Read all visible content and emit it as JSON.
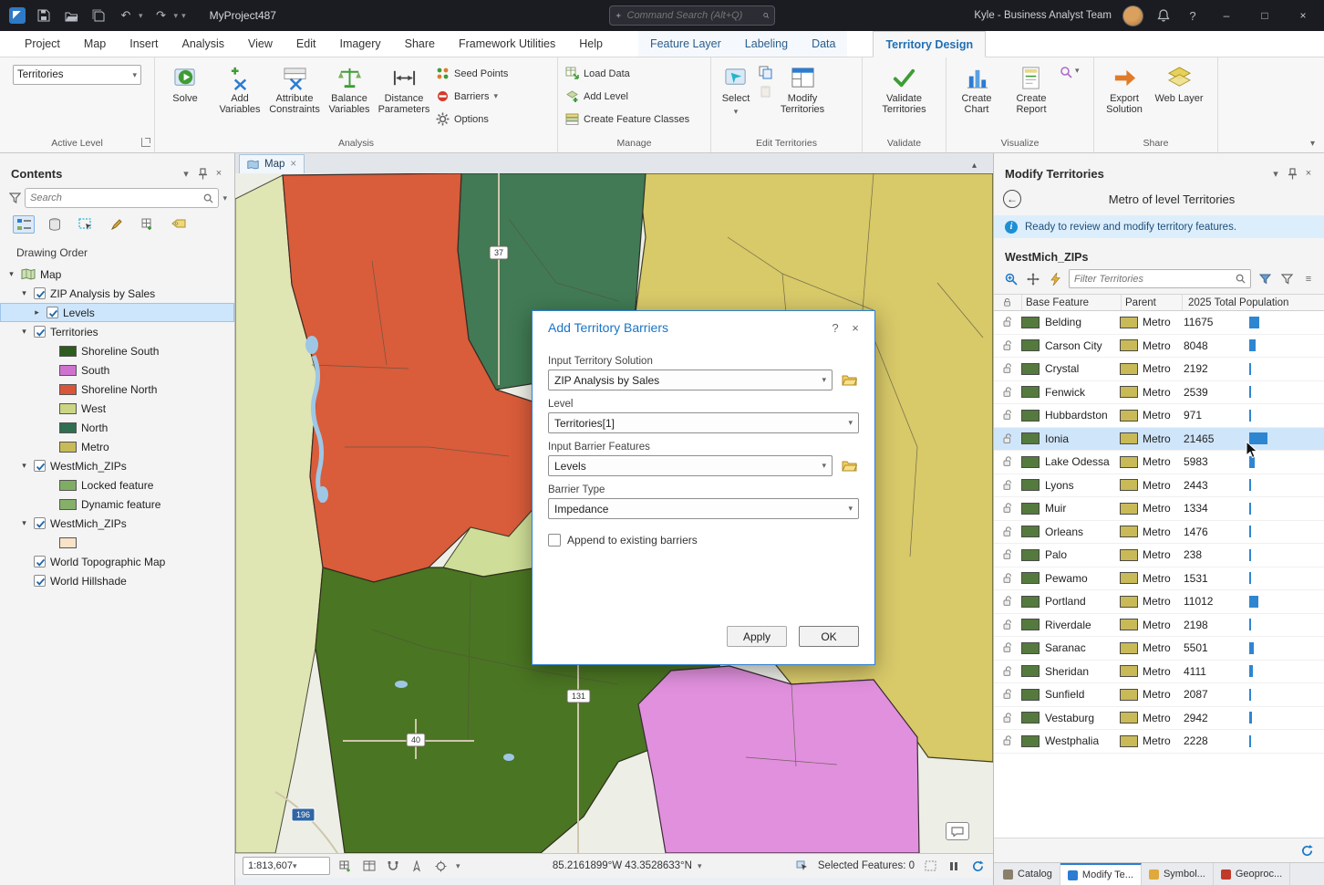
{
  "icons": {
    "help": "?",
    "close_x": "×",
    "minimize": "–",
    "maximize": "□",
    "chevron_down": "▾",
    "chevron_up": "▴",
    "undo": "↶",
    "redo": "↷",
    "hamburger": "≡"
  },
  "colors": {
    "accent": "#1f6fb5",
    "selection": "#cfe5fa",
    "info_bar": "#dceefb",
    "bar_blue": "#2e86d1",
    "territory_red": "#d95c3b",
    "territory_teal": "#417a54",
    "territory_khaki": "#d8c969",
    "territory_green": "#4a7522",
    "territory_pink": "#e190dd",
    "territory_lightgreen": "#cedd97"
  },
  "titlebar": {
    "project_name": "MyProject487",
    "search_placeholder": "Command Search (Alt+Q)",
    "user_label": "Kyle - Business Analyst Team"
  },
  "menu": {
    "tabs": [
      {
        "label": "Project"
      },
      {
        "label": "Map"
      },
      {
        "label": "Insert"
      },
      {
        "label": "Analysis"
      },
      {
        "label": "View"
      },
      {
        "label": "Edit"
      },
      {
        "label": "Imagery"
      },
      {
        "label": "Share"
      },
      {
        "label": "Framework Utilities"
      },
      {
        "label": "Help"
      }
    ],
    "context_tabs": [
      {
        "label": "Feature Layer"
      },
      {
        "label": "Labeling"
      },
      {
        "label": "Data"
      }
    ],
    "active_tab": "Territory Design"
  },
  "ribbon": {
    "active_level_value": "Territories",
    "solve_label": "Solve",
    "add_variables_label": "Add Variables",
    "attribute_constraints_label": "Attribute Constraints",
    "balance_variables_label": "Balance Variables",
    "distance_parameters_label": "Distance Parameters",
    "seed_points_label": "Seed Points",
    "barriers_label": "Barriers",
    "options_label": "Options",
    "load_data_label": "Load Data",
    "add_level_label": "Add Level",
    "create_feature_classes_label": "Create Feature Classes",
    "select_label": "Select",
    "modify_territories_label": "Modify Territories",
    "validate_territories_label": "Validate Territories",
    "create_chart_label": "Create Chart",
    "create_report_label": "Create Report",
    "export_solution_label": "Export Solution",
    "web_layer_label": "Web Layer",
    "group_labels": [
      "Active Level",
      "Analysis",
      "Manage",
      "Edit Territories",
      "Validate",
      "Visualize",
      "Share"
    ]
  },
  "contents": {
    "title": "Contents",
    "search_placeholder": "Search",
    "drawing_order_label": "Drawing Order",
    "tree": [
      {
        "glyph": "▾",
        "label": "Map",
        "depth": 0,
        "checked": null,
        "is_map": true
      },
      {
        "glyph": "▾",
        "label": "ZIP Analysis by Sales",
        "depth": 1,
        "checked": true
      },
      {
        "glyph": "▸",
        "label": "Levels",
        "depth": 2,
        "checked": true,
        "selected": true
      },
      {
        "glyph": "▾",
        "label": "Territories",
        "depth": 1,
        "checked": true
      },
      {
        "glyph": "",
        "label": "Shoreline South",
        "depth": 3,
        "swatch": "#2e5c1f"
      },
      {
        "glyph": "",
        "label": "South",
        "depth": 3,
        "swatch": "#cf72cf"
      },
      {
        "glyph": "",
        "label": "Shoreline North",
        "depth": 3,
        "swatch": "#d8553a"
      },
      {
        "glyph": "",
        "label": "West",
        "depth": 3,
        "swatch": "#ccd584"
      },
      {
        "glyph": "",
        "label": "North",
        "depth": 3,
        "swatch": "#2f6e50"
      },
      {
        "glyph": "",
        "label": "Metro",
        "depth": 3,
        "swatch": "#c8ba58"
      },
      {
        "glyph": "▾",
        "label": "WestMich_ZIPs",
        "depth": 1,
        "checked": true
      },
      {
        "glyph": "",
        "label": "Locked feature",
        "depth": 3,
        "swatch": "#7fae63",
        "hatched": true
      },
      {
        "glyph": "",
        "label": "Dynamic feature",
        "depth": 3,
        "swatch": "#86b06a"
      },
      {
        "glyph": "▾",
        "label": "WestMich_ZIPs",
        "depth": 1,
        "checked": true
      },
      {
        "glyph": "",
        "label": "",
        "depth": 3,
        "swatch": "#f8e3c8"
      },
      {
        "glyph": "",
        "label": "World Topographic Map",
        "depth": 1,
        "checked": true
      },
      {
        "glyph": "",
        "label": "World Hillshade",
        "depth": 1,
        "checked": true
      }
    ]
  },
  "map": {
    "tab_label": "Map",
    "shields": [
      "37",
      "131",
      "40",
      "196"
    ],
    "scale": "1:813,607",
    "coordinates": "85.2161899°W 43.3528633°N",
    "selected_features_label": "Selected Features: 0"
  },
  "dialog": {
    "title": "Add Territory Barriers",
    "fields": [
      {
        "label": "Input Territory Solution",
        "value": "ZIP Analysis by Sales"
      },
      {
        "label": "Level",
        "value": "Territories[1]"
      },
      {
        "label": "Input Barrier Features",
        "value": "Levels"
      },
      {
        "label": "Barrier Type",
        "value": "Impedance"
      }
    ],
    "checkbox_label": "Append to existing barriers",
    "apply_label": "Apply",
    "ok_label": "OK"
  },
  "modify_panel": {
    "title": "Modify Territories",
    "subtitle": "Metro of level Territories",
    "info_text": "Ready to review and modify territory features.",
    "layer_name": "WestMich_ZIPs",
    "filter_placeholder": "Filter Territories",
    "table": {
      "columns": [
        "Base Feature",
        "Parent",
        "2025 Total Population"
      ],
      "rows": [
        {
          "name": "Belding",
          "parent": "Metro",
          "pop": 11675
        },
        {
          "name": "Carson City",
          "parent": "Metro",
          "pop": 8048
        },
        {
          "name": "Crystal",
          "parent": "Metro",
          "pop": 2192
        },
        {
          "name": "Fenwick",
          "parent": "Metro",
          "pop": 2539
        },
        {
          "name": "Hubbardston",
          "parent": "Metro",
          "pop": 971
        },
        {
          "name": "Ionia",
          "parent": "Metro",
          "pop": 21465,
          "selected": true
        },
        {
          "name": "Lake Odessa",
          "parent": "Metro",
          "pop": 5983
        },
        {
          "name": "Lyons",
          "parent": "Metro",
          "pop": 2443
        },
        {
          "name": "Muir",
          "parent": "Metro",
          "pop": 1334
        },
        {
          "name": "Orleans",
          "parent": "Metro",
          "pop": 1476
        },
        {
          "name": "Palo",
          "parent": "Metro",
          "pop": 238
        },
        {
          "name": "Pewamo",
          "parent": "Metro",
          "pop": 1531
        },
        {
          "name": "Portland",
          "parent": "Metro",
          "pop": 11012
        },
        {
          "name": "Riverdale",
          "parent": "Metro",
          "pop": 2198
        },
        {
          "name": "Saranac",
          "parent": "Metro",
          "pop": 5501
        },
        {
          "name": "Sheridan",
          "parent": "Metro",
          "pop": 4111
        },
        {
          "name": "Sunfield",
          "parent": "Metro",
          "pop": 2087
        },
        {
          "name": "Vestaburg",
          "parent": "Metro",
          "pop": 2942
        },
        {
          "name": "Westphalia",
          "parent": "Metro",
          "pop": 2228
        }
      ]
    },
    "bottom_tabs": [
      {
        "label": "Catalog",
        "color": "#8a7f6a"
      },
      {
        "label": "Modify Te...",
        "color": "#2b7cd3",
        "active": true
      },
      {
        "label": "Symbol...",
        "color": "#e0a93c"
      },
      {
        "label": "Geoproc...",
        "color": "#c0392b"
      }
    ]
  }
}
